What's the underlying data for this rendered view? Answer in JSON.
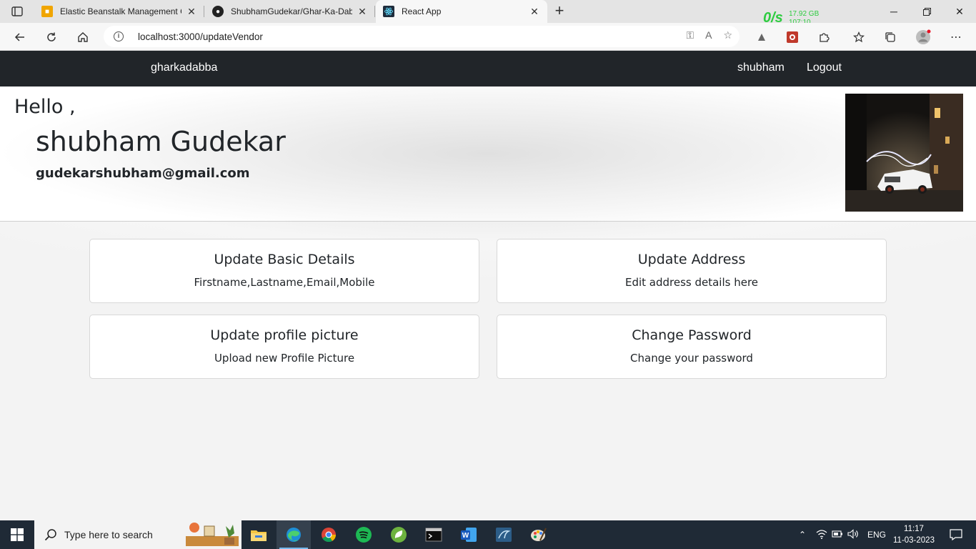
{
  "browser": {
    "tabs": [
      {
        "title": "Elastic Beanstalk Management Co",
        "icon": "aws-icon",
        "color": "#f0a500"
      },
      {
        "title": "ShubhamGudekar/Ghar-Ka-Dabb",
        "icon": "github-icon",
        "color": "#222222"
      },
      {
        "title": "React App",
        "icon": "react-icon",
        "color": "#1f2d3d"
      }
    ],
    "address": "localhost:3000/updateVendor",
    "net_monitor": {
      "speed": "0/s",
      "memory": "17.92 GB",
      "other": "107:10"
    }
  },
  "navbar": {
    "brand": "gharkadabba",
    "user": "shubham",
    "logout": "Logout"
  },
  "hero": {
    "greeting": "Hello ,",
    "fullname": "shubham Gudekar",
    "email": "gudekarshubham@gmail.com"
  },
  "cards": [
    {
      "title": "Update Basic Details",
      "subtitle": "Firstname,Lastname,Email,Mobile"
    },
    {
      "title": "Update Address",
      "subtitle": "Edit address details here"
    },
    {
      "title": "Update profile picture",
      "subtitle": "Upload new Profile Picture"
    },
    {
      "title": "Change Password",
      "subtitle": "Change your password"
    }
  ],
  "taskbar": {
    "search_placeholder": "Type here to search",
    "language": "ENG",
    "time": "11:17",
    "date": "11-03-2023"
  },
  "colors": {
    "navbar": "#212529",
    "netmon": "#2ecc40",
    "taskbar": "#1f2a36"
  }
}
